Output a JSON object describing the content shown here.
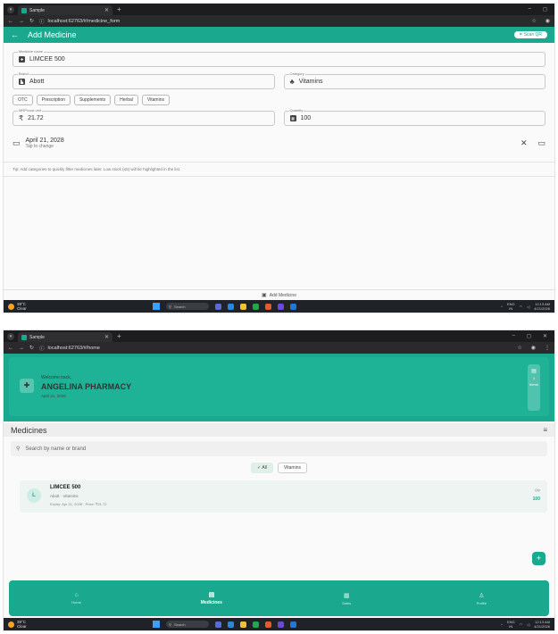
{
  "browser1": {
    "tab_title": "Sample",
    "url": "localhost:62763/#/medicine_form"
  },
  "browser2": {
    "tab_title": "Sample",
    "url": "localhost:62763/#/home"
  },
  "form": {
    "title": "Add Medicine",
    "scan_label": "Scan QR",
    "medicine_name_label": "Medicine name",
    "medicine_name_value": "LIMCEE 500",
    "brand_label": "Brand",
    "brand_value": "Abott",
    "category_label": "Category",
    "category_value": "Vitamins",
    "category_chips": [
      "OTC",
      "Prescription",
      "Supplements",
      "Herbal",
      "Vitamins"
    ],
    "price_label": "MRP/cost unit",
    "price_value": "21.72",
    "currency": "₹",
    "quantity_label": "Quantity",
    "quantity_value": "100",
    "expiry_date": "April 21, 2028",
    "expiry_hint": "Tap to change",
    "tip": "Tip: Add categories to quickly filter medicines later. Low stock (≤5) will be highlighted in the list.",
    "submit_label": "Add Medicine"
  },
  "home": {
    "welcome": "Welcome back,",
    "pharmacy_name": "ANGELINA PHARMACY",
    "date": "April 21, 2026",
    "badge_count": "1",
    "badge_label": "Items",
    "section_title": "Medicines",
    "search_placeholder": "Search by name or brand",
    "filters": [
      "All",
      "Vitamins"
    ],
    "medicine": {
      "avatar_letter": "L",
      "name": "LIMCEE 500",
      "meta": "Abott · Vitamins",
      "details": "Expiry: Apr 21, 2028 · Price: ₹21.72",
      "qty_label": "Qty",
      "qty": "100"
    },
    "nav": [
      {
        "label": "Home",
        "icon": "home-icon"
      },
      {
        "label": "Medicines",
        "icon": "pill-icon"
      },
      {
        "label": "Sales",
        "icon": "cart-icon"
      },
      {
        "label": "Profile",
        "icon": "person-icon"
      }
    ]
  },
  "taskbar": {
    "temp": "39°C",
    "weather": "Clear",
    "search": "Search",
    "lang": "ENG",
    "region": "IN",
    "time": "12:13 AM",
    "date": "4/21/2026"
  },
  "colors": {
    "accent": "#1aa98f",
    "chrome": "#2a2a2d"
  }
}
